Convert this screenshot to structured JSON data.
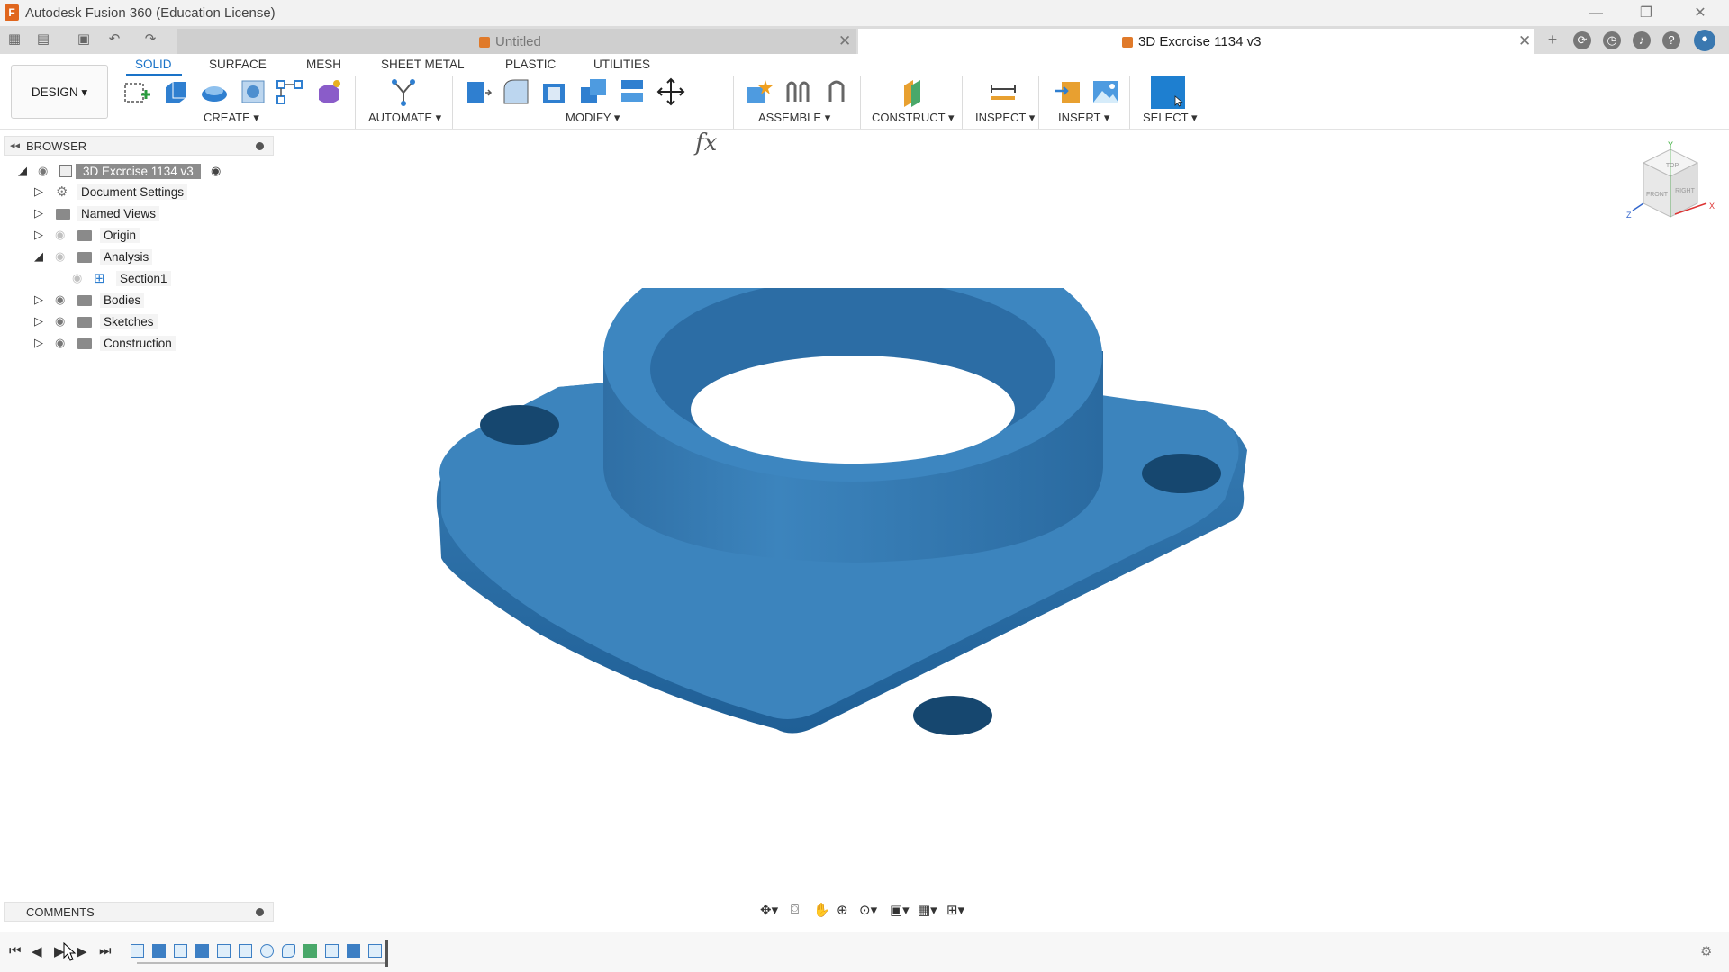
{
  "window": {
    "title": "Autodesk Fusion 360 (Education License)",
    "controls": [
      "—",
      "❐",
      "✕"
    ]
  },
  "tabs": [
    {
      "label": "Untitled",
      "active": false
    },
    {
      "label": "3D Excrcise 1134 v3",
      "active": true
    }
  ],
  "ribbon_tabs": [
    "SOLID",
    "SURFACE",
    "MESH",
    "SHEET METAL",
    "PLASTIC",
    "UTILITIES"
  ],
  "workspace": {
    "label": "DESIGN ▾"
  },
  "groups": {
    "create": "CREATE ▾",
    "automate": "AUTOMATE ▾",
    "modify": "MODIFY ▾",
    "assemble": "ASSEMBLE ▾",
    "construct": "CONSTRUCT ▾",
    "inspect": "INSPECT ▾",
    "insert": "INSERT ▾",
    "select": "SELECT ▾"
  },
  "browser": {
    "title": "BROWSER",
    "root": "3D Excrcise 1134 v3",
    "items": [
      {
        "label": "Document Settings",
        "icon": "gear-icon"
      },
      {
        "label": "Named Views",
        "icon": "folder-icon"
      },
      {
        "label": "Origin",
        "icon": "folder-icon"
      },
      {
        "label": "Analysis",
        "icon": "folder-icon"
      },
      {
        "label": "Section1",
        "icon": "section-icon"
      },
      {
        "label": "Bodies",
        "icon": "folder-icon"
      },
      {
        "label": "Sketches",
        "icon": "folder-icon"
      },
      {
        "label": "Construction",
        "icon": "folder-icon"
      }
    ]
  },
  "comments": {
    "title": "COMMENTS"
  },
  "viewcube": {
    "faces": [
      "TOP",
      "FRONT",
      "RIGHT"
    ],
    "axes": [
      "X",
      "Y",
      "Z"
    ]
  },
  "colors": {
    "accent": "#1a73c8",
    "model": "#3a80b8",
    "select_box": "#1e7fd0"
  }
}
